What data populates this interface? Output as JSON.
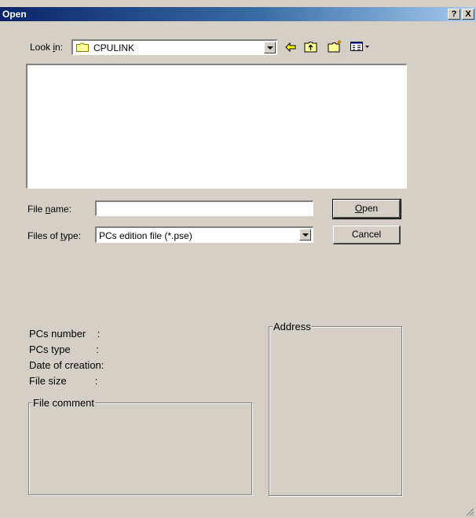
{
  "window": {
    "title": "Open",
    "help_btn": "?",
    "close_btn": "X"
  },
  "lookin": {
    "label_pre": "Look ",
    "label_u": "i",
    "label_post": "n:",
    "value": "CPULINK",
    "folder_icon": "folder-icon"
  },
  "toolbar": {
    "back_icon": "back-arrow-icon",
    "up_icon": "up-folder-icon",
    "new_icon": "new-folder-icon",
    "view_icon": "view-menu-icon"
  },
  "filename": {
    "label_pre": "File ",
    "label_u": "n",
    "label_post": "ame:",
    "value": "",
    "placeholder": ""
  },
  "filetype": {
    "label_pre": "Files of ",
    "label_u": "t",
    "label_post": "ype:",
    "value": "PCs edition file (*.pse)"
  },
  "buttons": {
    "open_u": "O",
    "open_rest": "pen",
    "cancel": "Cancel"
  },
  "info": {
    "pcs_number": "PCs number    :",
    "pcs_type": "PCs type         :",
    "date_of_creation": "Date of creation:",
    "file_size": "File size          :"
  },
  "groups": {
    "file_comment": "File comment",
    "address": "Address"
  }
}
